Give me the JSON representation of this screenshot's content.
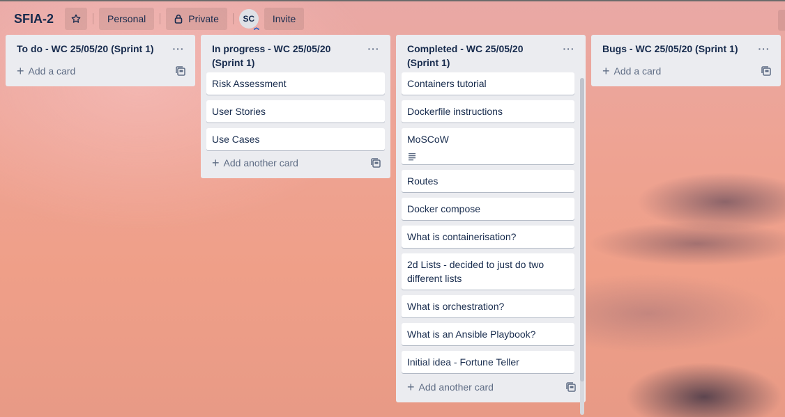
{
  "board": {
    "title": "SFIA-2",
    "workspace_label": "Personal",
    "visibility_label": "Private",
    "member_initials": "SC",
    "invite_label": "Invite"
  },
  "icons": {
    "star": "star-icon",
    "lock": "lock-icon",
    "list_menu": "ellipsis-icon",
    "add": "plus-icon",
    "template": "card-template-icon",
    "description": "description-icon"
  },
  "lists": [
    {
      "title": "To do - WC 25/05/20 (Sprint 1)",
      "cards": [],
      "add_label": "Add a card"
    },
    {
      "title": "In progress - WC 25/05/20 (Sprint 1)",
      "cards": [
        "Risk Assessment",
        "User Stories",
        "Use Cases"
      ],
      "add_label": "Add another card"
    },
    {
      "title": "Completed - WC 25/05/20 (Sprint 1)",
      "cards": [
        "Containers tutorial",
        "Dockerfile instructions",
        "MoSCoW",
        "Routes",
        "Docker compose",
        "What is containerisation?",
        "2d Lists - decided to just do two different lists",
        "What is orchestration?",
        "What is an Ansible Playbook?",
        "Initial idea - Fortune Teller"
      ],
      "add_label": "Add another card"
    },
    {
      "title": "Bugs - WC 25/05/20 (Sprint 1)",
      "cards": [],
      "add_label": "Add a card"
    }
  ],
  "list_menu_glyph": "···",
  "add_glyph": "+"
}
